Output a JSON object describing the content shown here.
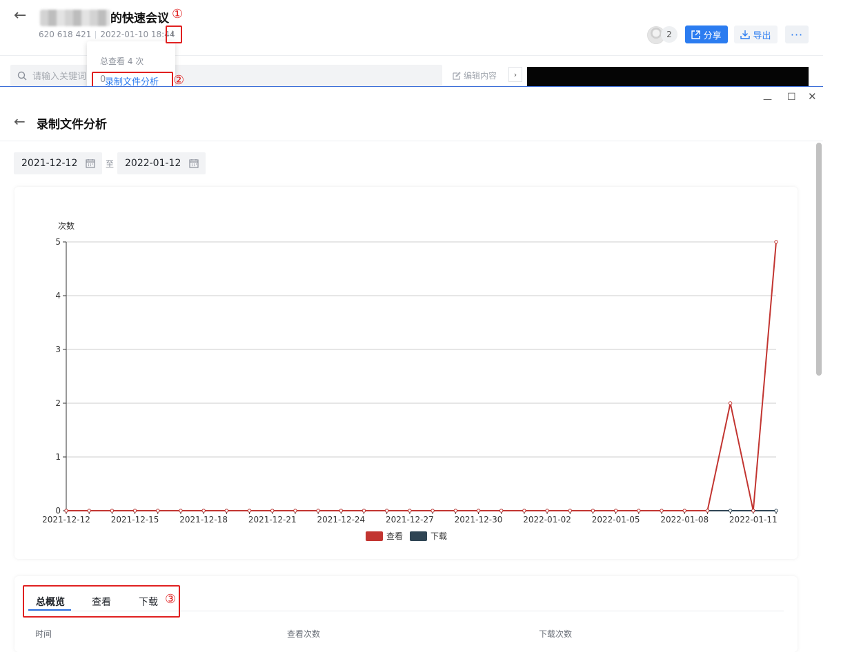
{
  "background_page": {
    "title": "的快速会议",
    "meeting_id": "620 618 421",
    "datetime": "2022-01-10 18:44",
    "info_icon": "i",
    "participant_count": "2",
    "share_label": "分享",
    "export_label": "导出",
    "more_label": "···",
    "search_placeholder": "请输入关键词",
    "edit_label": "编辑内容",
    "popover": {
      "total_views": "总查看 4 次",
      "link_prefix": "0",
      "link_label": "录制文件分析"
    }
  },
  "annotations": {
    "marker_1": "①",
    "marker_2": "②",
    "marker_3": "③"
  },
  "modal": {
    "title": "录制文件分析",
    "window_controls": {
      "minimize": "—",
      "maximize": "☐",
      "close": "✕"
    },
    "date_range": {
      "start": "2021-12-12",
      "separator": "至",
      "end": "2022-01-12"
    },
    "tabs": [
      "总概览",
      "查看",
      "下载"
    ],
    "table_headers": [
      "时间",
      "查看次数",
      "下载次数"
    ]
  },
  "colors": {
    "accent": "#2b7cf0",
    "series_view": "#c23531",
    "series_download": "#2f4554",
    "annotation_red": "#e02020"
  },
  "chart_data": {
    "type": "line",
    "ylabel": "次数",
    "xlabel": "",
    "ylim": [
      0,
      5
    ],
    "yticks": [
      0,
      1,
      2,
      3,
      4,
      5
    ],
    "grid": true,
    "legend_placement": "bottom",
    "x": [
      "2021-12-12",
      "2021-12-13",
      "2021-12-14",
      "2021-12-15",
      "2021-12-16",
      "2021-12-17",
      "2021-12-18",
      "2021-12-19",
      "2021-12-20",
      "2021-12-21",
      "2021-12-22",
      "2021-12-23",
      "2021-12-24",
      "2021-12-25",
      "2021-12-26",
      "2021-12-27",
      "2021-12-28",
      "2021-12-29",
      "2021-12-30",
      "2021-12-31",
      "2022-01-01",
      "2022-01-02",
      "2022-01-03",
      "2022-01-04",
      "2022-01-05",
      "2022-01-06",
      "2022-01-07",
      "2022-01-08",
      "2022-01-09",
      "2022-01-10",
      "2022-01-11",
      "2022-01-12"
    ],
    "xtick_labels": [
      "2021-12-12",
      "2021-12-15",
      "2021-12-18",
      "2021-12-21",
      "2021-12-24",
      "2021-12-27",
      "2021-12-30",
      "2022-01-02",
      "2022-01-05",
      "2022-01-08",
      "2022-01-11"
    ],
    "series": [
      {
        "name": "查看",
        "values": [
          0,
          0,
          0,
          0,
          0,
          0,
          0,
          0,
          0,
          0,
          0,
          0,
          0,
          0,
          0,
          0,
          0,
          0,
          0,
          0,
          0,
          0,
          0,
          0,
          0,
          0,
          0,
          0,
          0,
          2,
          0,
          5
        ]
      },
      {
        "name": "下载",
        "values": [
          0,
          0,
          0,
          0,
          0,
          0,
          0,
          0,
          0,
          0,
          0,
          0,
          0,
          0,
          0,
          0,
          0,
          0,
          0,
          0,
          0,
          0,
          0,
          0,
          0,
          0,
          0,
          0,
          0,
          0,
          0,
          0
        ]
      }
    ]
  }
}
